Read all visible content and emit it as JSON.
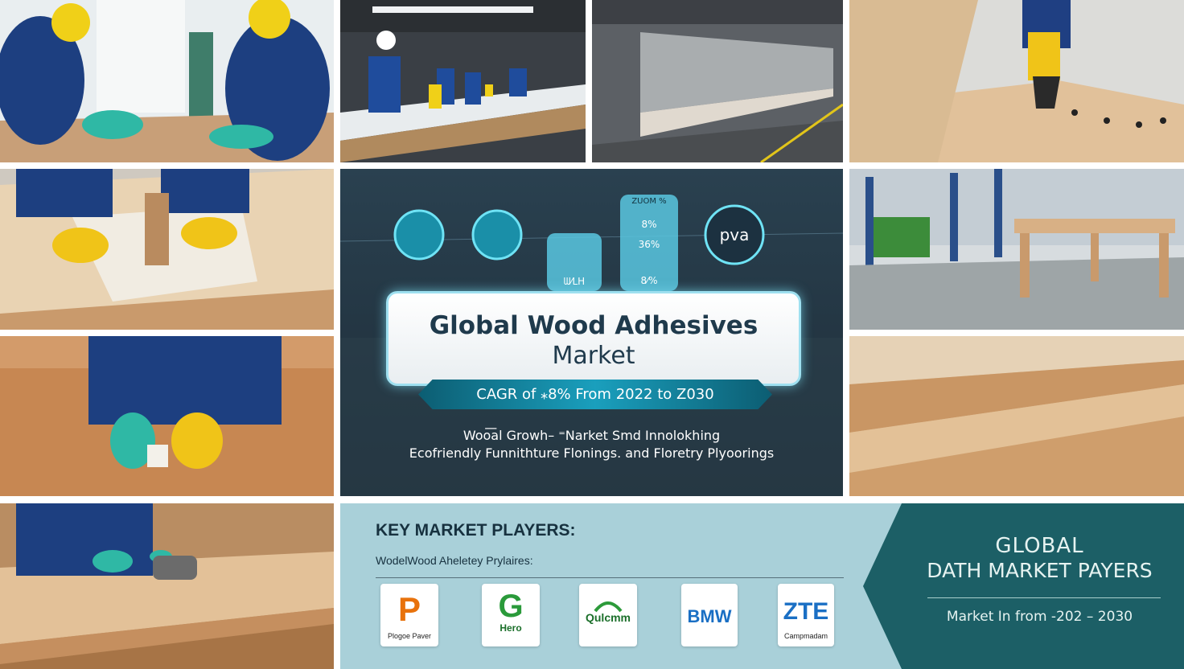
{
  "center": {
    "title_line1": "Global Wood Adhesives",
    "title_line2": "Market",
    "cagr": "CAGR of ⁎8% From 2022 to Z030",
    "subtitle_line1": "Woo͞al Growh– ⁼Narket Smd Innolokhing",
    "subtitle_line2": "Ecofriendly Funnithture Flonings. and Floretry Plyoorings",
    "gauges": {
      "pva_label": "pva",
      "tank_small_value": "ᗯ⁄ᒪᕼ",
      "tank_tall_top": "ZUOM %",
      "tank_tall_v1": "8%",
      "tank_tall_v2": "36%",
      "tank_tall_v3": "8⁄%"
    }
  },
  "key_players": {
    "title": "KEY MARKET PLAYERS:",
    "subtitle": "WodelWood Aheletey Prylaires:",
    "logos": [
      {
        "icon": "p-logo-icon",
        "caption": "Plogoe Paver",
        "mark": "P"
      },
      {
        "icon": "hero-logo-icon",
        "caption": "Hero",
        "mark": "G"
      },
      {
        "icon": "qulcom-logo-icon",
        "caption": "Qulcmm",
        "mark": ""
      },
      {
        "icon": "bmw-logo-icon",
        "caption": "",
        "mark": "BMW"
      },
      {
        "icon": "zte-logo-icon",
        "caption": "Campmadam",
        "mark": "ZTE"
      }
    ]
  },
  "badge": {
    "line1": "GLOBAL",
    "line2": "DATH MARKET PAYERS",
    "line3": "Market In from -202 – 2030"
  },
  "colors": {
    "panel_bg": "#a9d0d9",
    "badge_bg": "#1c5f66",
    "accent_cyan": "#1a9fbd",
    "title_text": "#1f3a4c"
  }
}
